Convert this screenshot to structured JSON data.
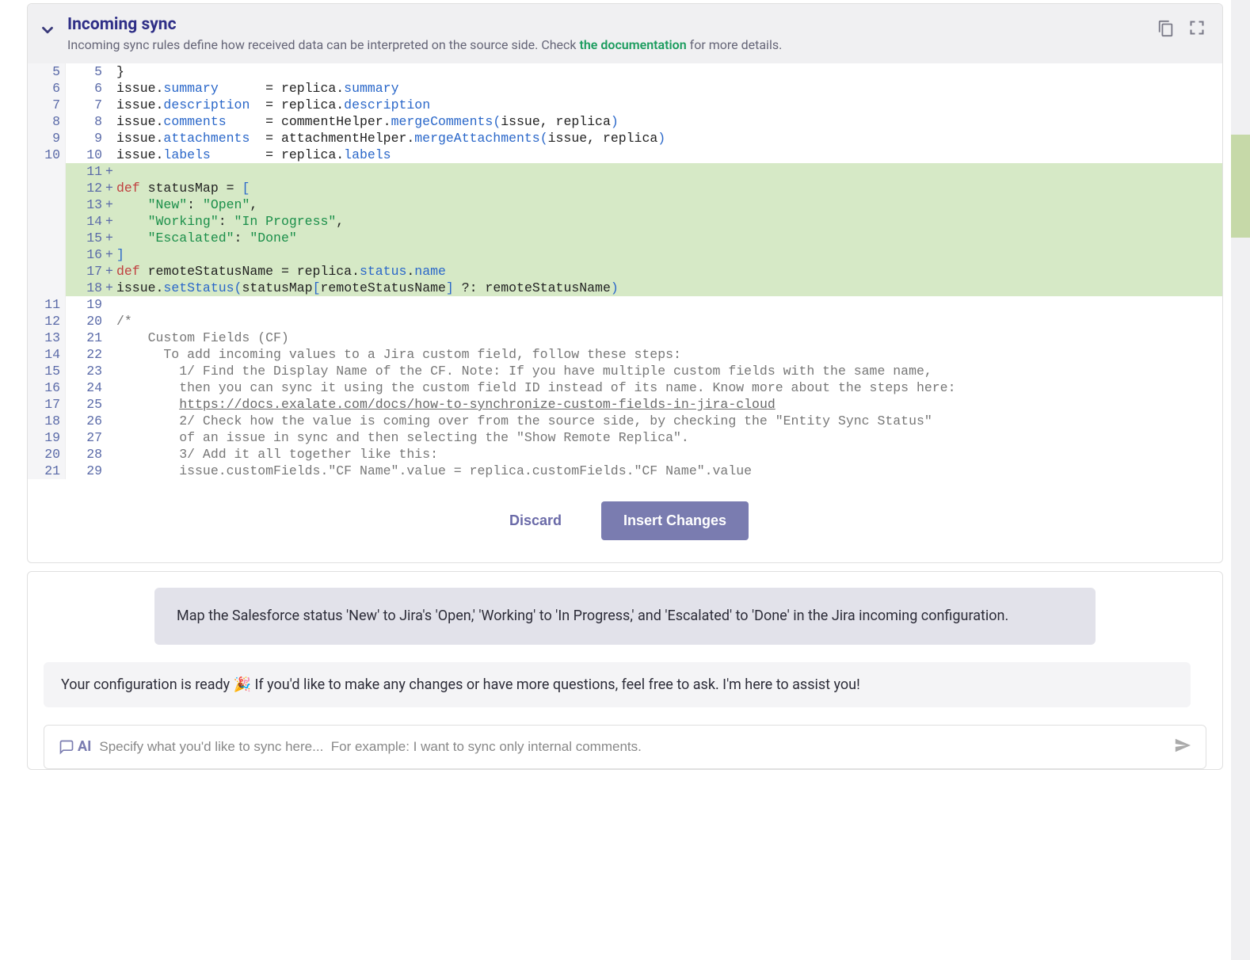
{
  "header": {
    "title": "Incoming sync",
    "subtitle_prefix": "Incoming sync rules define how received data can be interpreted on the source side. Check ",
    "doc_link_text": "the documentation",
    "subtitle_suffix": " for more details."
  },
  "code": {
    "lines": [
      {
        "old": "5",
        "new": "5",
        "added": false,
        "html": "<span class='t-punc'>}</span>"
      },
      {
        "old": "6",
        "new": "6",
        "added": false,
        "html": "issue.<span class='t-prop'>summary</span>      = replica.<span class='t-prop'>summary</span>"
      },
      {
        "old": "7",
        "new": "7",
        "added": false,
        "html": "issue.<span class='t-prop'>description</span>  = replica.<span class='t-prop'>description</span>"
      },
      {
        "old": "8",
        "new": "8",
        "added": false,
        "html": "issue.<span class='t-prop'>comments</span>     = commentHelper.<span class='t-func'>mergeComments</span><span class='t-paren'>(</span>issue<span class='t-punc'>,</span> replica<span class='t-paren'>)</span>"
      },
      {
        "old": "9",
        "new": "9",
        "added": false,
        "html": "issue.<span class='t-prop'>attachments</span>  = attachmentHelper.<span class='t-func'>mergeAttachments</span><span class='t-paren'>(</span>issue<span class='t-punc'>,</span> replica<span class='t-paren'>)</span>"
      },
      {
        "old": "10",
        "new": "10",
        "added": false,
        "html": "issue.<span class='t-prop'>labels</span>       = replica.<span class='t-prop'>labels</span>"
      },
      {
        "old": "",
        "new": "11",
        "added": true,
        "html": ""
      },
      {
        "old": "",
        "new": "12",
        "added": true,
        "html": "<span class='t-kw'>def</span> statusMap = <span class='t-brack'>[</span>"
      },
      {
        "old": "",
        "new": "13",
        "added": true,
        "html": "    <span class='t-str'>\"New\"</span>: <span class='t-str'>\"Open\"</span><span class='t-punc'>,</span>"
      },
      {
        "old": "",
        "new": "14",
        "added": true,
        "html": "    <span class='t-str'>\"Working\"</span>: <span class='t-str'>\"In Progress\"</span><span class='t-punc'>,</span>"
      },
      {
        "old": "",
        "new": "15",
        "added": true,
        "html": "    <span class='t-str'>\"Escalated\"</span>: <span class='t-str'>\"Done\"</span>"
      },
      {
        "old": "",
        "new": "16",
        "added": true,
        "html": "<span class='t-brack'>]</span>"
      },
      {
        "old": "",
        "new": "17",
        "added": true,
        "html": "<span class='t-kw'>def</span> remoteStatusName = replica.<span class='t-prop'>status</span>.<span class='t-prop'>name</span>"
      },
      {
        "old": "",
        "new": "18",
        "added": true,
        "html": "issue.<span class='t-func'>setStatus</span><span class='t-paren'>(</span>statusMap<span class='t-brack'>[</span>remoteStatusName<span class='t-brack'>]</span> ?: remoteStatusName<span class='t-paren'>)</span>"
      },
      {
        "old": "11",
        "new": "19",
        "added": false,
        "html": ""
      },
      {
        "old": "12",
        "new": "20",
        "added": false,
        "html": "<span class='t-comment'>/*</span>"
      },
      {
        "old": "13",
        "new": "21",
        "added": false,
        "html": "<span class='t-comment'>    Custom Fields (CF)</span>"
      },
      {
        "old": "14",
        "new": "22",
        "added": false,
        "html": "<span class='t-comment'>      To add incoming values to a Jira custom field, follow these steps:</span>"
      },
      {
        "old": "15",
        "new": "23",
        "added": false,
        "html": "<span class='t-comment'>        1/ Find the Display Name of the CF. Note: If you have multiple custom fields with the same name,</span>"
      },
      {
        "old": "16",
        "new": "24",
        "added": false,
        "html": "<span class='t-comment'>        then you can sync it using the custom field ID instead of its name. Know more about the steps here:</span>"
      },
      {
        "old": "17",
        "new": "25",
        "added": false,
        "html": "<span class='t-comment'>        </span><span class='t-link'>https://docs.exalate.com/docs/how-to-synchronize-custom-fields-in-jira-cloud</span>"
      },
      {
        "old": "18",
        "new": "26",
        "added": false,
        "html": "<span class='t-comment'>        2/ Check how the value is coming over from the source side, by checking the \"Entity Sync Status\"</span>"
      },
      {
        "old": "19",
        "new": "27",
        "added": false,
        "html": "<span class='t-comment'>        of an issue in sync and then selecting the \"Show Remote Replica\".</span>"
      },
      {
        "old": "20",
        "new": "28",
        "added": false,
        "html": "<span class='t-comment'>        3/ Add it all together like this:</span>"
      },
      {
        "old": "21",
        "new": "29",
        "added": false,
        "html": "<span class='t-comment'>        issue.customFields.\"CF Name\".value = replica.customFields.\"CF Name\".value</span>"
      }
    ]
  },
  "buttons": {
    "discard": "Discard",
    "insert": "Insert Changes"
  },
  "chat": {
    "user_message": "Map the Salesforce status 'New' to Jira's 'Open,' 'Working' to 'In Progress,' and 'Escalated' to 'Done' in the Jira incoming configuration.",
    "ai_message": "Your configuration is ready 🎉 If you'd like to make any changes or have more questions, feel free to ask. I'm here to assist you!",
    "ai_label": "AI",
    "input_placeholder": "Specify what you'd like to sync here...  For example: I want to sync only internal comments."
  }
}
